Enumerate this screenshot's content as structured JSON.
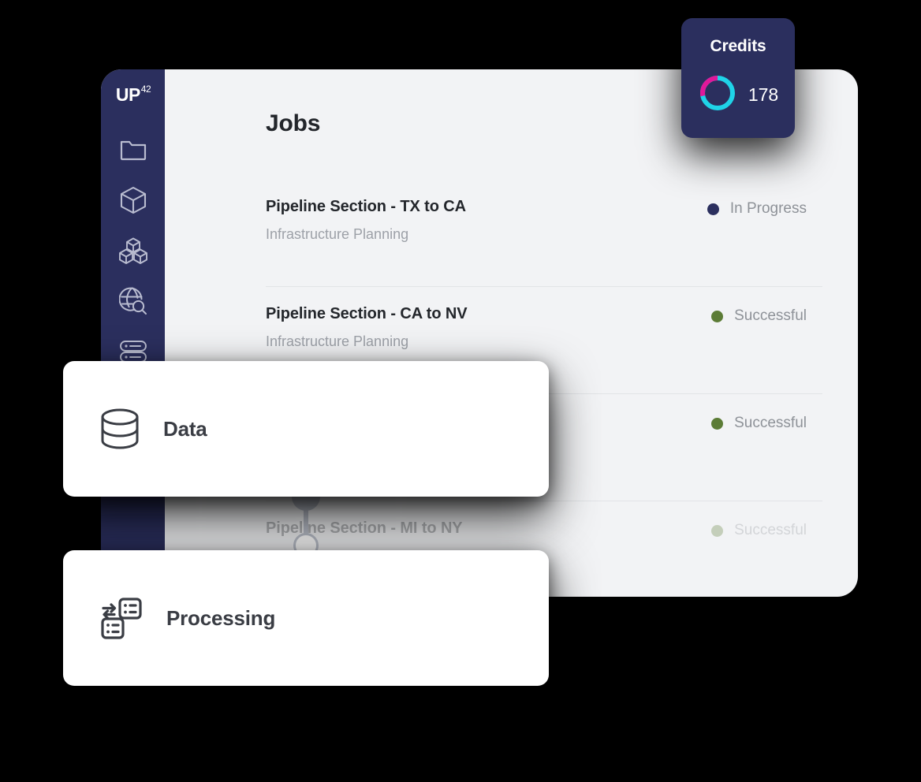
{
  "app": {
    "logo_text": "UP",
    "logo_superscript": "42",
    "sidebar_icons": [
      {
        "name": "folder-icon",
        "label": "Folder"
      },
      {
        "name": "cube-icon",
        "label": "Cube"
      },
      {
        "name": "blocks-icon",
        "label": "Blocks"
      },
      {
        "name": "globe-search-icon",
        "label": "Globe Search"
      },
      {
        "name": "database-icon",
        "label": "Database"
      }
    ]
  },
  "page": {
    "title": "Jobs"
  },
  "jobs": [
    {
      "title": "Pipeline Section - TX to CA",
      "subtitle": "Infrastructure Planning",
      "status": "In Progress",
      "status_color": "#2b2f5e"
    },
    {
      "title": "Pipeline Section - CA to NV",
      "subtitle": "Infrastructure Planning",
      "status": "Successful",
      "status_color": "#5c7c36"
    },
    {
      "title": "",
      "subtitle": "",
      "status": "Successful",
      "status_color": "#5c7c36"
    },
    {
      "title": "Pipeline Section - MI to NY",
      "subtitle": "",
      "status": "Successful",
      "status_color": "#5c7c36"
    }
  ],
  "credits": {
    "title": "Credits",
    "value": "178",
    "donut": {
      "magenta_percent": 28,
      "cyan_percent": 72,
      "magenta_color": "#e0189a",
      "cyan_color": "#1fd3e8",
      "track_color": "#2b2f5e"
    }
  },
  "overlays": [
    {
      "label": "Data",
      "icon": "database-icon"
    },
    {
      "label": "Processing",
      "icon": "processing-transfer-icon"
    }
  ],
  "colors": {
    "sidebar_bg": "#2b2f5e",
    "panel_bg": "#f2f3f5",
    "page_bg": "#000000",
    "text_primary": "#23262b",
    "text_muted": "#9da1a8",
    "divider": "#e2e4e7",
    "connector": "#bcc1cc"
  }
}
